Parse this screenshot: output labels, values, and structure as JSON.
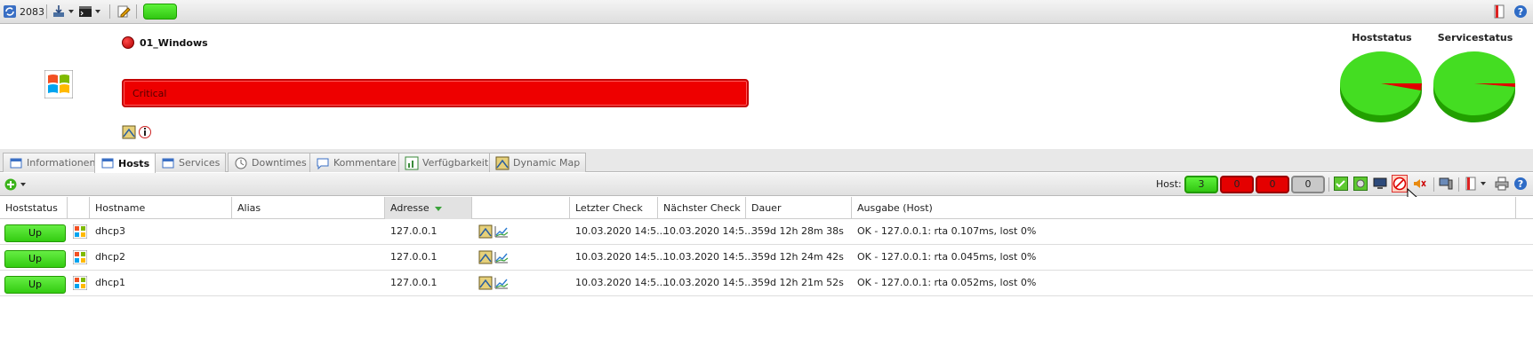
{
  "topbar": {
    "counter": "2083"
  },
  "header": {
    "host_group": "01_Windows",
    "status_label": "Critical",
    "pie_labels": [
      "Hoststatus",
      "Servicestatus"
    ]
  },
  "tabs": [
    {
      "label": "Informationen"
    },
    {
      "label": "Hosts"
    },
    {
      "label": "Services"
    },
    {
      "label": "Downtimes"
    },
    {
      "label": "Kommentare"
    },
    {
      "label": "Verfügbarkeit"
    },
    {
      "label": "Dynamic Map"
    }
  ],
  "toolbar": {
    "host_label": "Host:",
    "counts": [
      "3",
      "0",
      "0",
      "0"
    ]
  },
  "table": {
    "headers": [
      "Hoststatus",
      "",
      "Hostname",
      "Alias",
      "Adresse",
      "",
      "Letzter Check",
      "Nächster Check",
      "Dauer",
      "Ausgabe (Host)"
    ],
    "rows": [
      {
        "status": "Up",
        "hostname": "dhcp3",
        "alias": "",
        "address": "127.0.0.1",
        "last_check": "10.03.2020 14:5...",
        "next_check": "10.03.2020 14:5...",
        "duration": "359d 12h 28m 38s",
        "output": "OK - 127.0.0.1: rta 0.107ms, lost 0%"
      },
      {
        "status": "Up",
        "hostname": "dhcp2",
        "alias": "",
        "address": "127.0.0.1",
        "last_check": "10.03.2020 14:5...",
        "next_check": "10.03.2020 14:5...",
        "duration": "359d 12h 24m 42s",
        "output": "OK - 127.0.0.1: rta 0.045ms, lost 0%"
      },
      {
        "status": "Up",
        "hostname": "dhcp1",
        "alias": "",
        "address": "127.0.0.1",
        "last_check": "10.03.2020 14:5...",
        "next_check": "10.03.2020 14:5...",
        "duration": "359d 12h 21m 52s",
        "output": "OK - 127.0.0.1: rta 0.052ms, lost 0%"
      }
    ]
  },
  "colors": {
    "ok": "#33cc11",
    "critical": "#ee0000",
    "neutral": "#c8c8c8"
  },
  "icons": [
    "refresh-icon",
    "download-icon",
    "terminal-icon",
    "edit-icon",
    "bookmark-icon",
    "help-icon",
    "windows-logo-icon",
    "map-icon",
    "info-icon",
    "add-icon",
    "print-icon",
    "graph-icon"
  ]
}
